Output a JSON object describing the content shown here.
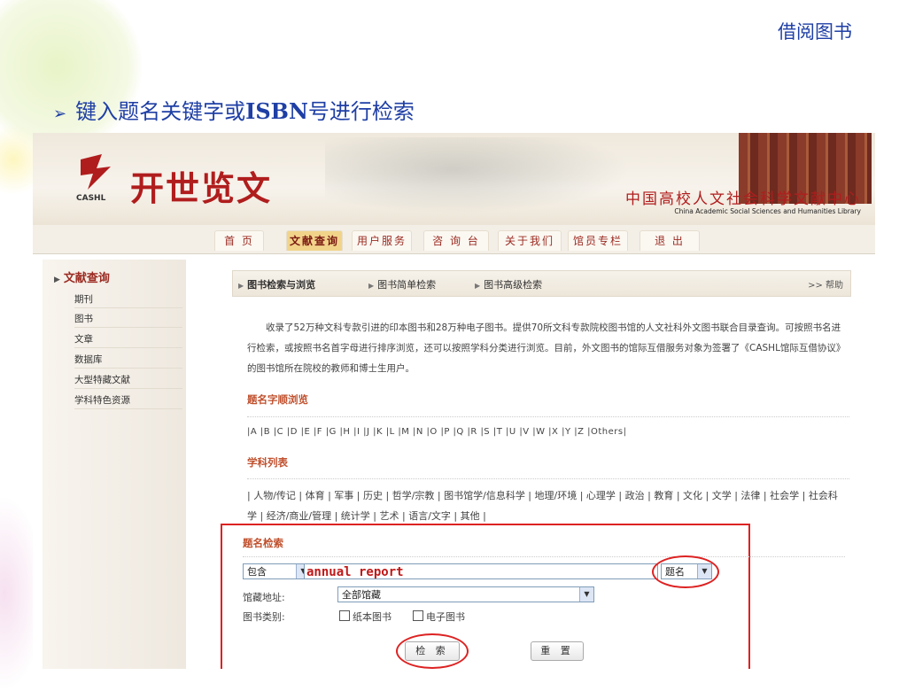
{
  "slide": {
    "corner_title": "借阅图书",
    "heading_prefix": "键入题名关键字或",
    "heading_bold": "ISBN",
    "heading_suffix": "号进行检索"
  },
  "site": {
    "logo_name": "开世览文",
    "logo_sub": "CASHL",
    "institution_cn": "中国高校人文社会科学文献中心",
    "institution_en": "China Academic Social Sciences and Humanities Library"
  },
  "nav": {
    "items": [
      "首 页",
      "文献查询",
      "用户服务",
      "咨 询 台",
      "关于我们",
      "馆员专栏",
      "退 出"
    ],
    "active_index": 1
  },
  "sidebar": {
    "heading": "文献查询",
    "items": [
      "期刊",
      "图书",
      "文章",
      "数据库",
      "大型特藏文献",
      "学科特色资源"
    ]
  },
  "tabs": {
    "items": [
      "图书检索与浏览",
      "图书简单检索",
      "图书高级检索"
    ],
    "help": ">> 帮助"
  },
  "intro": "收录了52万种文科专款引进的印本图书和28万种电子图书。提供70所文科专款院校图书馆的人文社科外文图书联合目录查询。可按照书名进行检索，或按照书名首字母进行排序浏览，还可以按照学科分类进行浏览。目前，外文图书的馆际互借服务对象为签署了《CASHL馆际互借协议》的图书馆所在院校的教师和博士生用户。",
  "title_browse": {
    "heading": "题名字顺浏览",
    "letters": "|A |B |C |D |E |F |G |H |I |J |K |L |M |N |O |P |Q |R |S |T |U |V |W |X |Y |Z |Others|"
  },
  "subject_list": {
    "heading": "学科列表",
    "text": "| 人物/传记 | 体育 | 军事 | 历史 | 哲学/宗教 | 图书馆学/信息科学 | 地理/环境 | 心理学 | 政治 | 教育 | 文化 | 文学 | 法律 | 社会学 | 社会科学 | 经济/商业/管理 | 统计学 | 艺术 | 语言/文字 | 其他 |"
  },
  "search": {
    "heading": "题名检索",
    "match_mode": "包含",
    "query": "annual report",
    "field": "题名",
    "location_label": "馆藏地址:",
    "location_value": "全部馆藏",
    "type_label": "图书类别:",
    "type_print": "纸本图书",
    "type_ebook": "电子图书",
    "search_button": "检 索",
    "reset_button": "重 置"
  },
  "colors": {
    "title_blue": "#1f3fa5",
    "brand_red": "#b01d1d",
    "highlight_red": "#dd2222",
    "section_orange": "#c0502d"
  }
}
